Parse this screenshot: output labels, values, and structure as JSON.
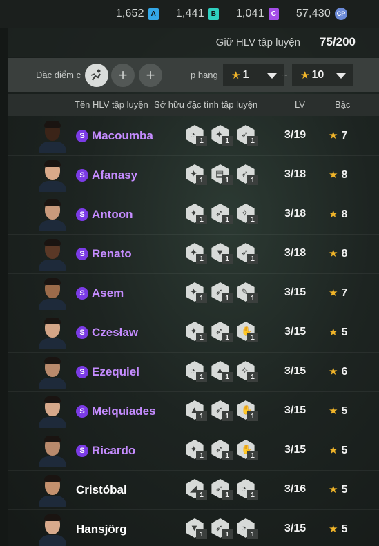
{
  "currencies": [
    {
      "amount": "1,652",
      "icon": "A"
    },
    {
      "amount": "1,441",
      "icon": "B"
    },
    {
      "amount": "1,041",
      "icon": "C"
    },
    {
      "amount": "57,430",
      "icon": "CP"
    }
  ],
  "coach_count": {
    "label": "Giữ HLV tập luyện",
    "value": "75/200"
  },
  "filters": {
    "trait_label": "Đặc điểm c",
    "grade_label": "p hạng",
    "grade_min": "1",
    "grade_max": "10",
    "tilde": "~",
    "plus": "+"
  },
  "columns": {
    "name": "Tên HLV tập luyện",
    "traits": "Sở hữu đặc tính tập luyện",
    "lv": "LV",
    "grade": "Bậc"
  },
  "colors": {
    "special_name": "#c58cff",
    "star": "#f0b429",
    "s_badge": "#7b3be6"
  },
  "coaches": [
    {
      "name": "Macoumba",
      "special": true,
      "badge": "S",
      "lv": "3/19",
      "grade": "7",
      "skin": "#3b2418",
      "traits": [
        {
          "icon": "whistle-icon",
          "level": "1"
        },
        {
          "icon": "strength-icon",
          "level": "1"
        },
        {
          "icon": "sprint-icon",
          "level": "1"
        }
      ]
    },
    {
      "name": "Afanasy",
      "special": true,
      "badge": "S",
      "lv": "3/18",
      "grade": "8",
      "skin": "#d9a98a",
      "traits": [
        {
          "icon": "strength-icon",
          "level": "1"
        },
        {
          "icon": "clipboard-icon",
          "level": "1"
        },
        {
          "icon": "sprint-icon",
          "level": "1"
        }
      ]
    },
    {
      "name": "Antoon",
      "special": true,
      "badge": "S",
      "lv": "3/18",
      "grade": "8",
      "skin": "#c99a7c",
      "traits": [
        {
          "icon": "strength-icon",
          "level": "1"
        },
        {
          "icon": "sprint-icon",
          "level": "1"
        },
        {
          "icon": "kick-icon",
          "level": "1"
        }
      ]
    },
    {
      "name": "Renato",
      "special": true,
      "badge": "S",
      "lv": "3/18",
      "grade": "8",
      "skin": "#5a3826",
      "traits": [
        {
          "icon": "strength-icon",
          "level": "1"
        },
        {
          "icon": "tie-icon",
          "level": "1"
        },
        {
          "icon": "sprint-icon",
          "level": "1"
        }
      ]
    },
    {
      "name": "Asem",
      "special": true,
      "badge": "S",
      "lv": "3/15",
      "grade": "7",
      "skin": "#9c6b4a",
      "traits": [
        {
          "icon": "strength-icon",
          "level": "1"
        },
        {
          "icon": "sprint-icon",
          "level": "1"
        },
        {
          "icon": "tactics-icon",
          "level": "1"
        }
      ]
    },
    {
      "name": "Czesław",
      "special": true,
      "badge": "S",
      "lv": "3/15",
      "grade": "5",
      "skin": "#d4a587",
      "traits": [
        {
          "icon": "strength-icon",
          "level": "1"
        },
        {
          "icon": "sprint-icon",
          "level": "1"
        },
        {
          "icon": "goalkeeper-icon",
          "level": "1"
        }
      ]
    },
    {
      "name": "Ezequiel",
      "special": true,
      "badge": "S",
      "lv": "3/15",
      "grade": "6",
      "skin": "#b98a6c",
      "traits": [
        {
          "icon": "whistle-icon",
          "level": "1"
        },
        {
          "icon": "cone-icon",
          "level": "1"
        },
        {
          "icon": "kick-icon",
          "level": "1"
        }
      ]
    },
    {
      "name": "Melquíades",
      "special": true,
      "badge": "S",
      "lv": "3/15",
      "grade": "5",
      "skin": "#d6a88a",
      "traits": [
        {
          "icon": "cone-icon",
          "level": "1"
        },
        {
          "icon": "sprint-icon",
          "level": "1"
        },
        {
          "icon": "goalkeeper-icon",
          "level": "1"
        }
      ]
    },
    {
      "name": "Ricardo",
      "special": true,
      "badge": "S",
      "lv": "3/15",
      "grade": "5",
      "skin": "#b98a6c",
      "traits": [
        {
          "icon": "strength-icon",
          "level": "1"
        },
        {
          "icon": "sprint-icon",
          "level": "1"
        },
        {
          "icon": "goalkeeper-icon",
          "level": "1"
        }
      ]
    },
    {
      "name": "Cristóbal",
      "special": false,
      "badge": "",
      "lv": "3/16",
      "grade": "5",
      "skin": "#c4916e",
      "traits": [
        {
          "icon": "shoe-icon",
          "level": "1"
        },
        {
          "icon": "sprint-icon",
          "level": "1"
        },
        {
          "icon": "whistle-icon",
          "level": "1"
        }
      ]
    },
    {
      "name": "Hansjörg",
      "special": false,
      "badge": "",
      "lv": "3/15",
      "grade": "5",
      "skin": "#d8aa8c",
      "traits": [
        {
          "icon": "tie-icon",
          "level": "1"
        },
        {
          "icon": "sprint-icon",
          "level": "1"
        },
        {
          "icon": "whistle-icon",
          "level": "1"
        }
      ]
    }
  ]
}
